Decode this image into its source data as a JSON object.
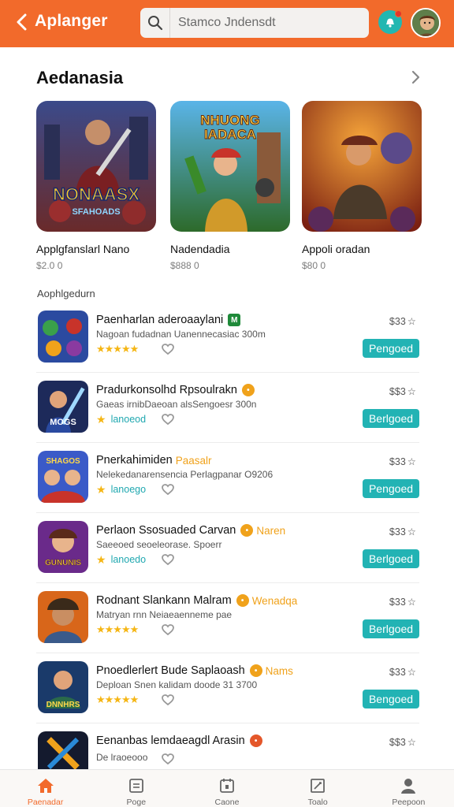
{
  "header": {
    "title": "Aplanger",
    "search_placeholder": "Stamco Jndensdt",
    "brand_color": "#f26a2b"
  },
  "featured": {
    "section_title": "Aedanasia",
    "items": [
      {
        "name": "Applgfanslarl Nano",
        "price": "$2.0 0",
        "art_text_1": "NONAASX",
        "art_text_2": "SFAHOADS"
      },
      {
        "name": "Nadendadia",
        "price": "$888 0",
        "art_text_1": "NHUONG",
        "art_text_2": "IADACA"
      },
      {
        "name": "Appoli oradan",
        "price": "$80 0"
      }
    ]
  },
  "list_section": {
    "label": "Aophlgedurn",
    "rows": [
      {
        "title": "Paenharlan aderoaaylani",
        "badge": "M",
        "badge_color": "#1f8a3a",
        "tag": "",
        "desc": "Nagoan fudadnan Uanennecasiac 300m",
        "rating_type": "stars",
        "rating_text": "★★★★★",
        "price": "$33",
        "button": "Pengoed",
        "icon_text": ""
      },
      {
        "title": "Pradurkonsolhd Rpsoulrakn",
        "badge": "•",
        "badge_color": "#f0a21b",
        "tag": "",
        "desc": "Gaeas irnibDaeoan alsSengoesr 300n",
        "rating_type": "single",
        "rating_text": "lanoeod",
        "price": "$$3",
        "button": "Berlgoed",
        "icon_text": "MOGS"
      },
      {
        "title": "Pnerkahimiden",
        "badge": "",
        "badge_color": "",
        "tag": "Paasalr",
        "desc": "Nelekedanarensencia Perlagpanar O9206",
        "rating_type": "single",
        "rating_text": "lanoego",
        "price": "$33",
        "button": "Pengoed",
        "icon_text": "SHAGOS"
      },
      {
        "title": "Perlaon Ssosuaded Carvan",
        "badge": "•",
        "badge_color": "#f0a21b",
        "tag": "Naren",
        "desc": "Saeeoed seoeleorase. Spoerr",
        "rating_type": "single",
        "rating_text": "lanoedo",
        "price": "$33",
        "button": "Berlgoed",
        "icon_text": "GUNUNIS"
      },
      {
        "title": "Rodnant Slankann Malram",
        "badge": "•",
        "badge_color": "#f0a21b",
        "tag": "Wenadqa",
        "desc": "Matryan rnn Neiaeaenneme pae",
        "rating_type": "stars",
        "rating_text": "★★★★★",
        "price": "$33",
        "button": "Berlgoed",
        "icon_text": ""
      },
      {
        "title": "Pnoedlerlert Bude Saplaoash",
        "badge": "•",
        "badge_color": "#f0a21b",
        "tag": "Nams",
        "desc": "Deploan Snen kalidam doode 31 3700",
        "rating_type": "stars",
        "rating_text": "★★★★★",
        "price": "$33",
        "button": "Bengoed",
        "icon_text": "DNNHRS"
      },
      {
        "title": "Eenanbas lemdaeagdl Arasin",
        "badge": "•",
        "badge_color": "#e4572a",
        "tag": "",
        "desc": "",
        "rating_type": "none",
        "rating_text": "De lraoeooo",
        "price": "$$3",
        "button": "",
        "icon_text": ""
      }
    ]
  },
  "bottom_nav": [
    {
      "label": "Paenadar",
      "icon": "home-icon",
      "active": true
    },
    {
      "label": "Poge",
      "icon": "page-icon",
      "active": false
    },
    {
      "label": "Caone",
      "icon": "calendar-icon",
      "active": false
    },
    {
      "label": "Toalo",
      "icon": "tools-icon",
      "active": false
    },
    {
      "label": "Peepoon",
      "icon": "person-icon",
      "active": false
    }
  ]
}
